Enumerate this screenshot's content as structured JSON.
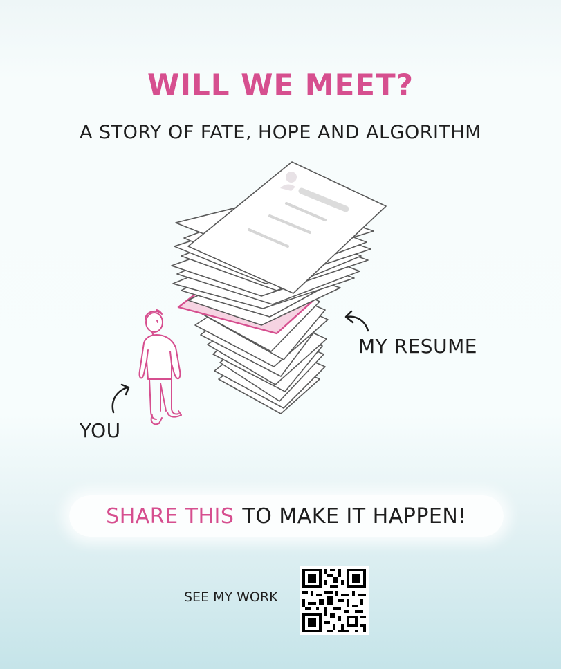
{
  "title": "WILL WE MEET?",
  "subtitle": "A STORY OF FATE, HOPE AND ALGORITHM",
  "labels": {
    "my_resume": "MY RESUME",
    "you": "YOU"
  },
  "share": {
    "accent": "SHARE THIS",
    "rest": "TO MAKE IT HAPPEN!"
  },
  "see_work": "SEE MY WORK",
  "colors": {
    "accent": "#d64f8f",
    "text": "#1e1e1e",
    "paper_fill": "#ffffff",
    "paper_stroke": "#5a5a5a",
    "highlight_paper": "#f6d3e2",
    "background_top": "#f7fdfd",
    "background_bottom": "#c5e4e9"
  },
  "icons": {
    "paper_stack": "paper-stack-illustration",
    "person": "person-illustration",
    "arrow_resume": "curved-arrow-icon",
    "arrow_you": "curved-arrow-icon",
    "qr_code": "qr-code-icon"
  }
}
